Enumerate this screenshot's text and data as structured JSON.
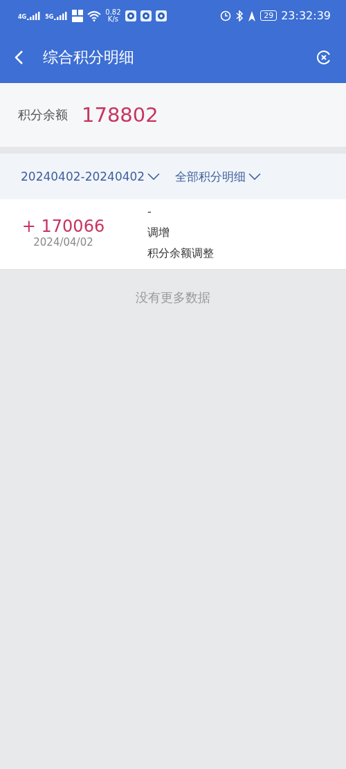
{
  "status_bar": {
    "network_1": "4G",
    "network_2": "5G",
    "speed_value": "0.82",
    "speed_unit": "K/s",
    "battery": "29",
    "time": "23:32:39"
  },
  "header": {
    "title": "综合积分明细"
  },
  "balance": {
    "label": "积分余额",
    "value": "178802"
  },
  "filters": [
    {
      "label": "20240402-20240402"
    },
    {
      "label": "全部积分明细"
    }
  ],
  "records": [
    {
      "amount": "+ 170066",
      "date": "2024/04/02",
      "lines": [
        "-",
        "调增",
        "积分余额调整"
      ]
    }
  ],
  "footer_note": "没有更多数据"
}
